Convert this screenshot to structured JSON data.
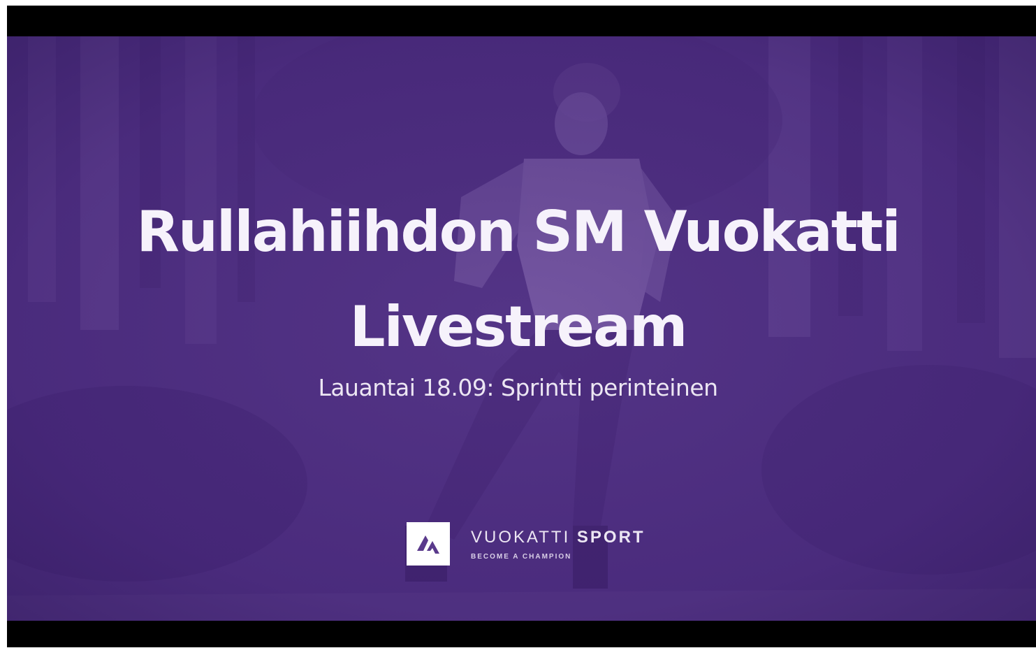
{
  "title": {
    "line1": "Rullahiihdon SM Vuokatti",
    "line2": "Livestream"
  },
  "subtitle": "Lauantai 18.09: Sprintti perinteinen",
  "brand": {
    "name_light": "VUOKATTI",
    "name_bold": "SPORT",
    "tagline": "BECOME A CHAMPION",
    "logo_icon": "vuokatti-sport-logo"
  },
  "colors": {
    "overlay": "#5a3a8c",
    "text": "#f6f2fb",
    "letterbox": "#000000"
  }
}
